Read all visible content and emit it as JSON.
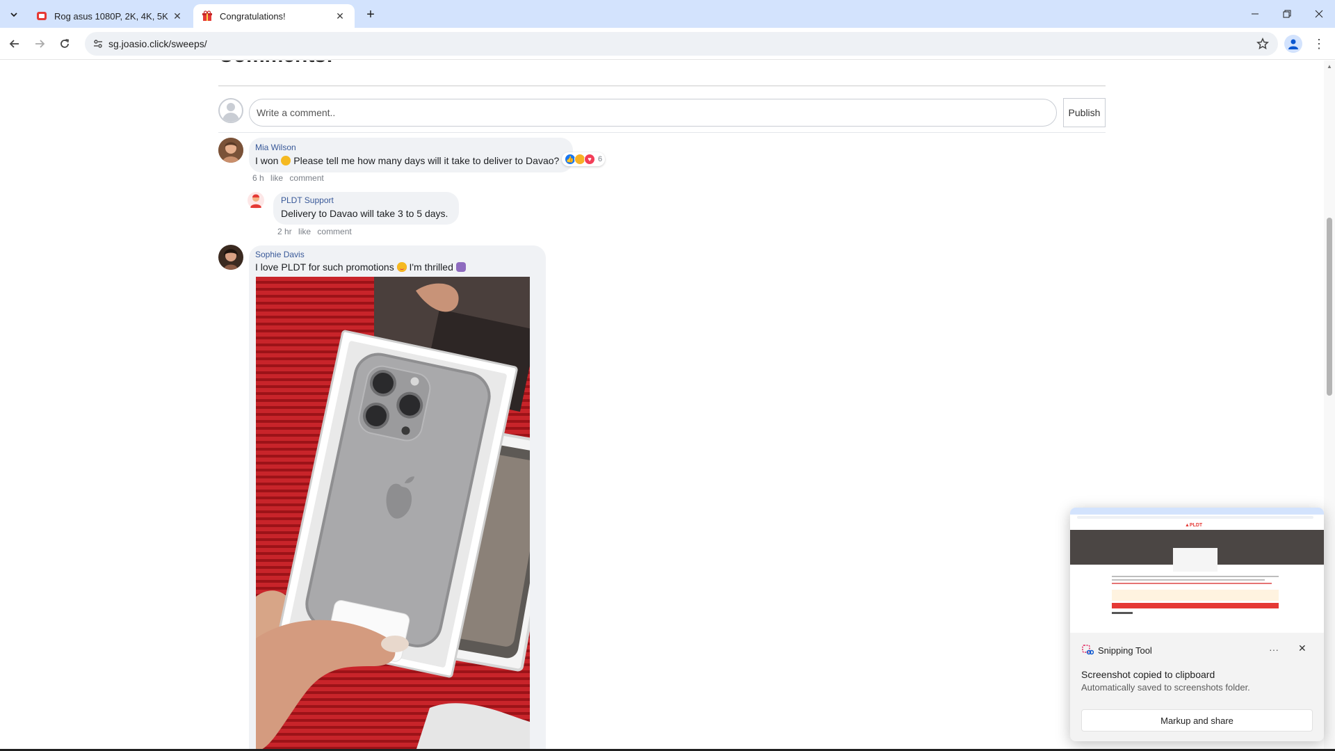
{
  "browser": {
    "tabs": [
      {
        "title": "Rog asus 1080P, 2K, 4K, 5K HD",
        "active": false
      },
      {
        "title": "Congratulations!",
        "active": true
      }
    ],
    "url": "sg.joasio.click/sweeps/"
  },
  "comments_section": {
    "heading": "Comments:",
    "input_placeholder": "Write a comment..",
    "publish_label": "Publish",
    "comments": [
      {
        "author": "Mia Wilson",
        "text_before_emoji": "I won",
        "text_after_emoji": " Please tell me how many days will it take to deliver to Davao?",
        "reaction_count": "6",
        "time": "6 h",
        "like_label": "like",
        "comment_label": "comment",
        "reply": {
          "author": "PLDT Support",
          "text": "Delivery to Davao will take 3 to 5 days.",
          "time": "2 hr",
          "like_label": "like",
          "comment_label": "comment"
        }
      },
      {
        "author": "Sophie Davis",
        "text_before_emoji": "I love PLDT for such promotions",
        "text_after_emoji": " I'm thrilled"
      }
    ]
  },
  "toast": {
    "app_name": "Snipping Tool",
    "headline": "Screenshot copied to clipboard",
    "subtext": "Automatically saved to screenshots folder.",
    "action_label": "Markup and share"
  },
  "colors": {
    "tab_strip": "#d3e3fd",
    "author_link": "#385898",
    "bubble": "#f0f2f5",
    "photo_red": "#c62026"
  }
}
